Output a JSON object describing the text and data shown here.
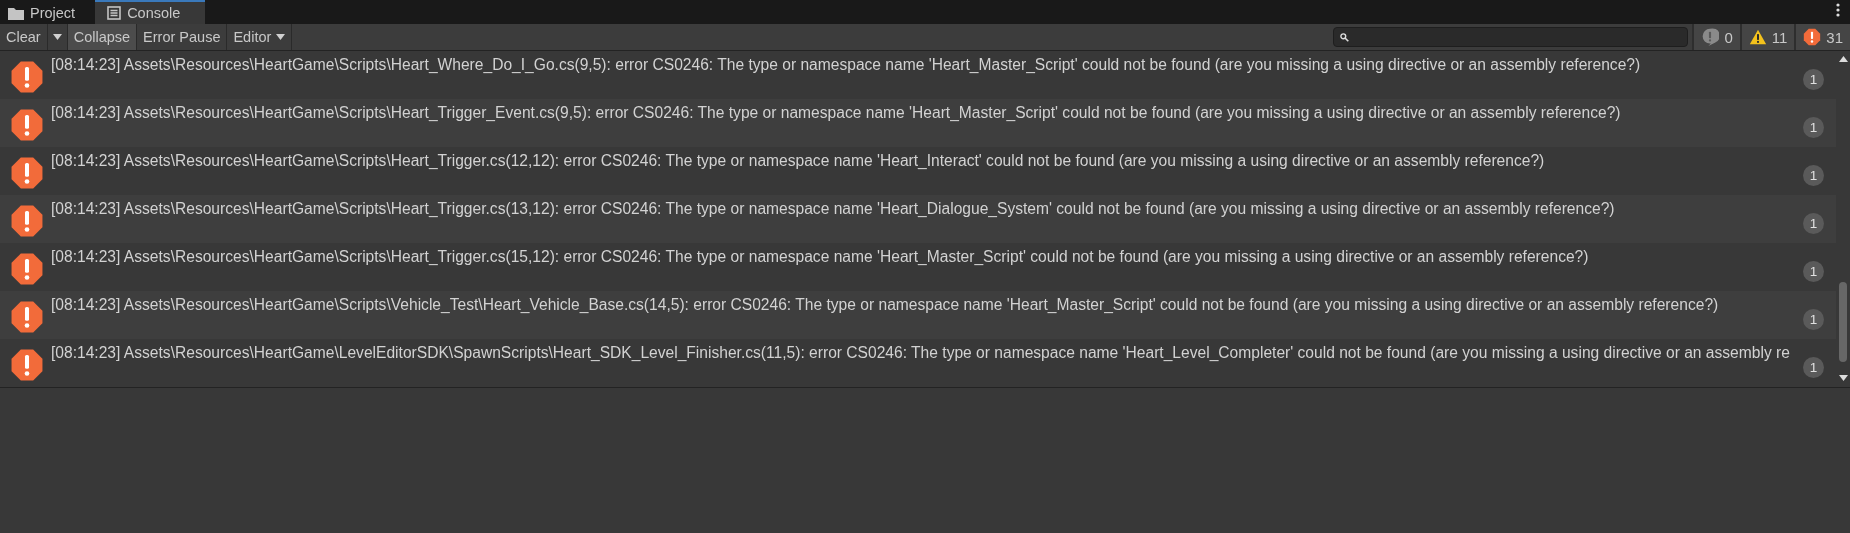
{
  "tabs": [
    {
      "kind": "folder",
      "label": "Project",
      "selected": false
    },
    {
      "kind": "console",
      "label": "Console",
      "selected": true
    }
  ],
  "toolbar": {
    "clear": {
      "label": "Clear"
    },
    "toggles": [
      {
        "label": "Collapse",
        "on": true
      },
      {
        "label": "Error Pause",
        "on": false
      }
    ],
    "editor": {
      "label": "Editor"
    },
    "counters": [
      {
        "kind": "info",
        "count": "0"
      },
      {
        "kind": "warning",
        "count": "11"
      },
      {
        "kind": "error",
        "count": "31"
      }
    ]
  },
  "log": [
    {
      "kind": "error",
      "message": "[08:14:23] Assets\\Resources\\HeartGame\\Scripts\\Heart_Where_Do_I_Go.cs(9,5): error CS0246: The type or namespace name 'Heart_Master_Script' could not be found (are you missing a using directive or an assembly reference?)",
      "count": "1"
    },
    {
      "kind": "error",
      "message": "[08:14:23] Assets\\Resources\\HeartGame\\Scripts\\Heart_Trigger_Event.cs(9,5): error CS0246: The type or namespace name 'Heart_Master_Script' could not be found (are you missing a using directive or an assembly reference?)",
      "count": "1"
    },
    {
      "kind": "error",
      "message": "[08:14:23] Assets\\Resources\\HeartGame\\Scripts\\Heart_Trigger.cs(12,12): error CS0246: The type or namespace name 'Heart_Interact' could not be found (are you missing a using directive or an assembly reference?)",
      "count": "1"
    },
    {
      "kind": "error",
      "message": "[08:14:23] Assets\\Resources\\HeartGame\\Scripts\\Heart_Trigger.cs(13,12): error CS0246: The type or namespace name 'Heart_Dialogue_System' could not be found (are you missing a using directive or an assembly reference?)",
      "count": "1"
    },
    {
      "kind": "error",
      "message": "[08:14:23] Assets\\Resources\\HeartGame\\Scripts\\Heart_Trigger.cs(15,12): error CS0246: The type or namespace name 'Heart_Master_Script' could not be found (are you missing a using directive or an assembly reference?)",
      "count": "1"
    },
    {
      "kind": "error",
      "message": "[08:14:23] Assets\\Resources\\HeartGame\\Scripts\\Vehicle_Test\\Heart_Vehicle_Base.cs(14,5): error CS0246: The type or namespace name 'Heart_Master_Script' could not be found (are you missing a using directive or an assembly reference?)",
      "count": "1"
    },
    {
      "kind": "error",
      "message": "[08:14:23] Assets\\Resources\\HeartGame\\LevelEditorSDK\\SpawnScripts\\Heart_SDK_Level_Finisher.cs(11,5): error CS0246: The type or namespace name 'Heart_Level_Completer' could not be found (are you missing a using directive or an assembly re",
      "count": "1"
    }
  ]
}
